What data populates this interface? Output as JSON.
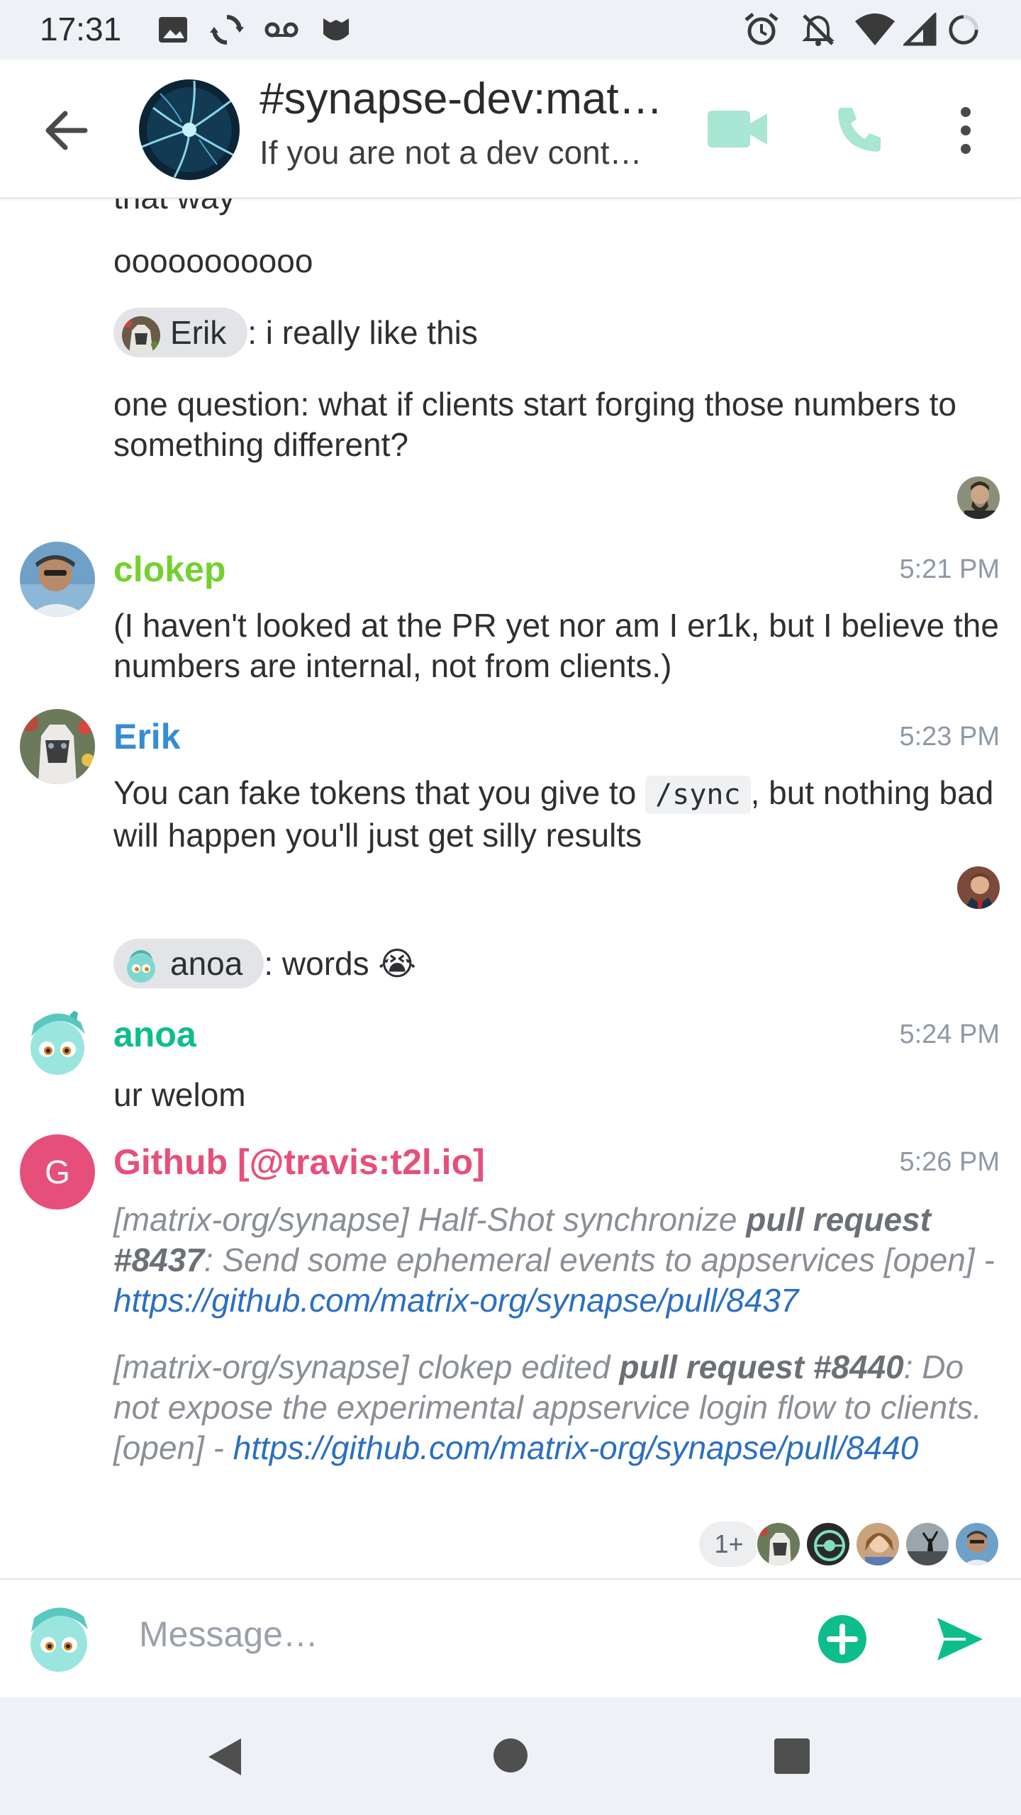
{
  "status_bar": {
    "time": "17:31",
    "icons": [
      "image-icon",
      "sync-icon",
      "voicemail-icon",
      "app-icon",
      "alarm-icon",
      "notifications-off-icon",
      "wifi-icon",
      "signal-icon",
      "battery-icon"
    ]
  },
  "header": {
    "room_name": "#synapse-dev:mat…",
    "topic": "If you are not a dev cont…",
    "buttons": [
      "back-icon",
      "video-call-icon",
      "voice-call-icon",
      "more-icon"
    ]
  },
  "timeline": {
    "cut_off_text": "that way",
    "msg_o": "ooooooooooo",
    "pill_erik": "Erik",
    "msg_like": ": i really like this",
    "msg_question": "one question: what if clients start forging those numbers to something different?",
    "clokep": {
      "name": "clokep",
      "time": "5:21 PM",
      "body": "(I haven't looked at the PR yet nor am I er1k, but I believe the numbers are internal, not from clients.)"
    },
    "erik": {
      "name": "Erik",
      "time": "5:23 PM",
      "body_pre": "You can fake tokens that you give to ",
      "code": "/sync",
      "body_post": ", but nothing bad will happen you'll just get silly results"
    },
    "pill_anoa": "anoa",
    "msg_words": ": words 😭",
    "anoa": {
      "name": "anoa",
      "time": "5:24 PM",
      "body": "ur welom"
    },
    "github": {
      "avatar_letter": "G",
      "name": "Github [@travis:t2l.io]",
      "time": "5:26 PM",
      "n1_pre": "[matrix-org/synapse] Half-Shot synchronize ",
      "n1_bold": "pull request #8437",
      "n1_post": ": Send some ephemeral events to appservices [open] - ",
      "n1_link": "https://github.com/matrix-org/synapse/pull/8437",
      "n2_pre": "[matrix-org/synapse] clokep edited ",
      "n2_bold": "pull request #8440",
      "n2_post": ": Do not expose the experimental appservice login flow to clients. [open] - ",
      "n2_link": "https://github.com/matrix-org/synapse/pull/8440"
    },
    "receipts_more": "1+"
  },
  "composer": {
    "placeholder": "Message…"
  },
  "colors": {
    "accent": "#0dbd8b",
    "clokep": "#74d12c",
    "erik": "#368bd6",
    "anoa": "#0dbd8b",
    "github": "#e64f7a"
  }
}
